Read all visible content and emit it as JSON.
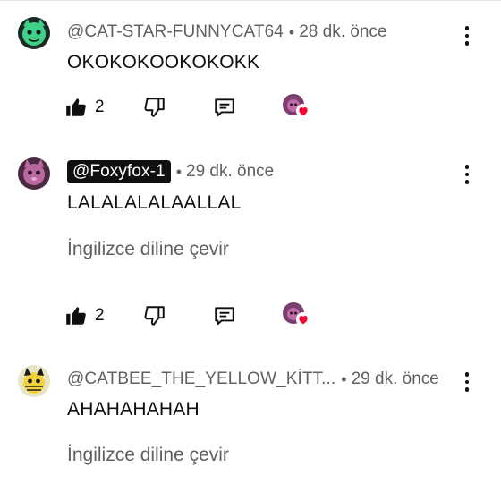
{
  "colors": {
    "text": "#0f0f0f",
    "secondary": "#606060",
    "heart": "#ff0033",
    "pill_bg": "#0f0f0f"
  },
  "comments": [
    {
      "author": "@CAT-STAR-FUNNYCAT64",
      "separator": "•",
      "time": "28 dk. önce",
      "text": "OKOKOKOOKOKOKK",
      "likes": "2",
      "avatar_icon": "green-cat-avatar",
      "heart": true
    },
    {
      "author": "@Foxyfox-1",
      "separator": "•",
      "time": "29 dk. önce",
      "text": "LALALALALAALLAL",
      "translate": "İngilizce diline çevir",
      "likes": "2",
      "avatar_icon": "purple-fox-avatar",
      "heart": true
    },
    {
      "author": "@CATBEE_THE_YELLOW_KİTT...",
      "separator": "•",
      "time": "29 dk. önce",
      "text": "AHAHAHAHAH",
      "translate": "İngilizce diline çevir",
      "avatar_icon": "yellow-cat-avatar"
    }
  ]
}
